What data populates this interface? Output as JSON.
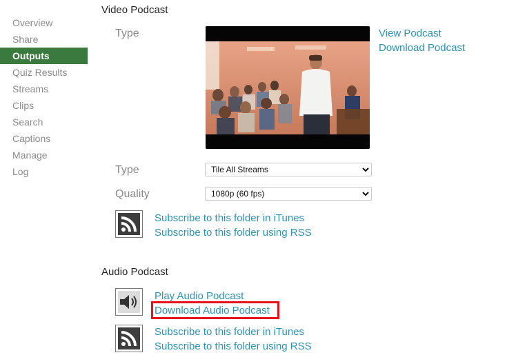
{
  "sidebar": {
    "items": [
      {
        "label": "Overview"
      },
      {
        "label": "Share"
      },
      {
        "label": "Outputs",
        "active": true
      },
      {
        "label": "Quiz Results"
      },
      {
        "label": "Streams"
      },
      {
        "label": "Clips"
      },
      {
        "label": "Search"
      },
      {
        "label": "Captions"
      },
      {
        "label": "Manage"
      },
      {
        "label": "Log"
      }
    ]
  },
  "video_podcast": {
    "title": "Video Podcast",
    "type_label": "Type",
    "view_link": "View Podcast",
    "download_link": "Download Podcast",
    "stream_type_label": "Type",
    "stream_type_value": "Tile All Streams",
    "quality_label": "Quality",
    "quality_value": "1080p (60 fps)",
    "subscribe_itunes": "Subscribe to this folder in iTunes",
    "subscribe_rss": "Subscribe to this folder using RSS"
  },
  "audio_podcast": {
    "title": "Audio Podcast",
    "play_link": "Play Audio Podcast",
    "download_link": "Download Audio Podcast",
    "subscribe_itunes": "Subscribe to this folder in iTunes",
    "subscribe_rss": "Subscribe to this folder using RSS"
  },
  "icons": {
    "rss": "rss-icon",
    "speaker": "speaker-icon"
  },
  "colors": {
    "active_nav": "#3a7a3e",
    "link": "#2a92b8",
    "highlight": "#e8131a"
  }
}
